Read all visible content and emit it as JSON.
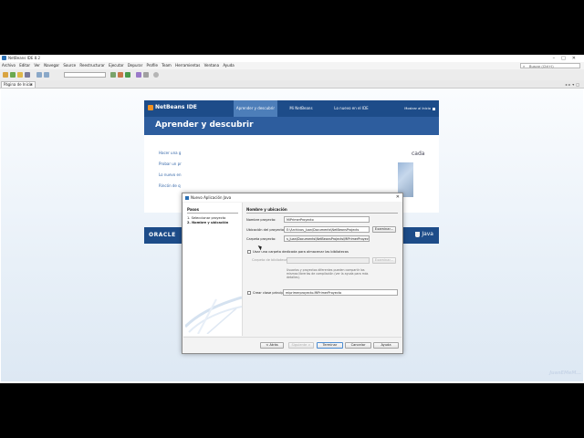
{
  "window": {
    "title": "NetBeans IDE 8.2"
  },
  "menu": [
    "Archivo",
    "Editar",
    "Ver",
    "Navegar",
    "Source",
    "Reestructurar",
    "Ejecutar",
    "Depurar",
    "Profile",
    "Team",
    "Herramientas",
    "Ventana",
    "Ayuda"
  ],
  "search": {
    "placeholder": "Buscar (Ctrl+I)"
  },
  "tab": {
    "label": "Página de Inicio"
  },
  "start_page": {
    "tabs": {
      "learn": "Aprender y descubrir",
      "my": "Mi NetBeans",
      "whats_new": "Lo nuevo en el IDE"
    },
    "show_on_startup": "Mostrar al Inicio",
    "banner_title": "Aprender y descubrir",
    "links": [
      "Hacer una g",
      "Probar un pr",
      "Lo nuevo en",
      "Rincón de q"
    ],
    "right_text": "cada",
    "logo": "NetBeans IDE",
    "footer_left": "ORACLE",
    "footer_right": "Java"
  },
  "dialog": {
    "title": "Nuevo Aplicación Java",
    "steps_heading": "Pasos",
    "steps": [
      "1.   Seleccionar proyecto",
      "2.   Nombre y ubicación"
    ],
    "section": "Nombre y ubicación",
    "project_name_label": "Nombre proyecto:",
    "project_name_value": "MiPrimerProyecto",
    "location_label": "Ubicación del proyecto:",
    "location_value": "E:\\Archivos_Juan\\Documents\\NetBeansProjects",
    "browse": "Examinar...",
    "folder_label": "Carpeta proyecto:",
    "folder_value": "s_Juan\\Documents\\NetBeansProjects\\MiPrimerProyecto",
    "use_lib_folder": "Usar una carpeta dedicada para almacenar las bibliotecas",
    "lib_folder_label": "Carpeta de bibliotecas:",
    "lib_browse": "Examinar...",
    "lib_hint": "Usuarios y proyectos diferentes pueden compartir las mismas librerías de compilación (ver la ayuda para más detalles).",
    "main_class_label": "Crear clase principal",
    "main_class_value": "miprimerproyecto.MiPrimerProyecto",
    "buttons": {
      "back": "< Atrás",
      "next": "Siguiente >",
      "finish": "Terminar",
      "cancel": "Cancelar",
      "help": "Ayuda"
    }
  },
  "watermark": "JuanEMeM..."
}
